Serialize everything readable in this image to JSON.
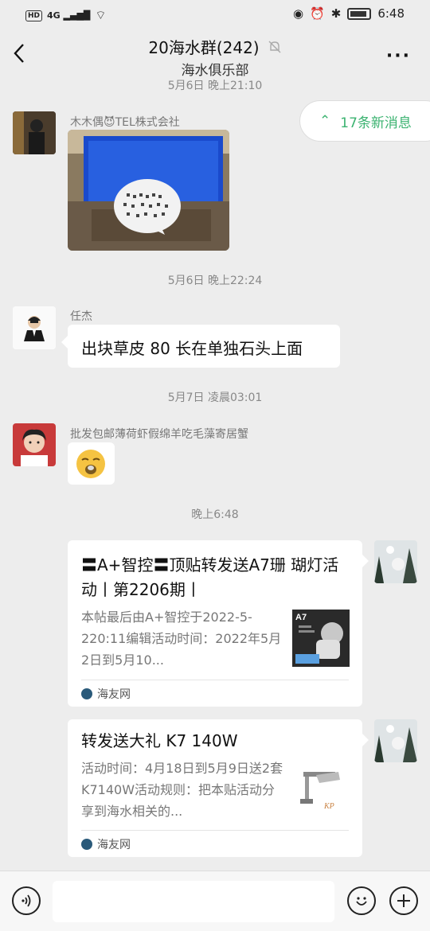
{
  "status_bar": {
    "hd": "HD",
    "signal": "4G",
    "time": "6:48"
  },
  "header": {
    "title": "20海水群(242)",
    "subtitle": "海水俱乐部"
  },
  "timestamps": [
    "5月6日 晚上21:10",
    "5月6日 晚上22:24",
    "5月7日 凌晨03:01",
    "晚上6:48"
  ],
  "new_messages": "17条新消息",
  "messages": [
    {
      "sender": "木木偶😈TEL株式会社",
      "type": "image"
    },
    {
      "sender": "任杰",
      "type": "text",
      "text": "出块草皮 80 长在单独石头上面"
    },
    {
      "sender": "批发包邮薄荷虾假绵羊吃毛藻寄居蟹",
      "type": "sticker"
    }
  ],
  "cards": [
    {
      "title": "〓A+智控〓顶贴转发送A7珊 瑚灯活动丨第2206期丨",
      "desc": "本帖最后由A+智控于2022-5-220:11编辑活动时间：2022年5月2日到5月10...",
      "thumb_label": "A7",
      "source": "海友网"
    },
    {
      "title": "转发送大礼 K7 140W",
      "desc": "活动时间：4月18日到5月9日送2套K7140W活动规则：把本贴活动分享到海水相关的...",
      "thumb_label": "KP",
      "source": "海友网"
    }
  ],
  "colors": {
    "accent": "#3cb371",
    "background": "#ededed"
  }
}
